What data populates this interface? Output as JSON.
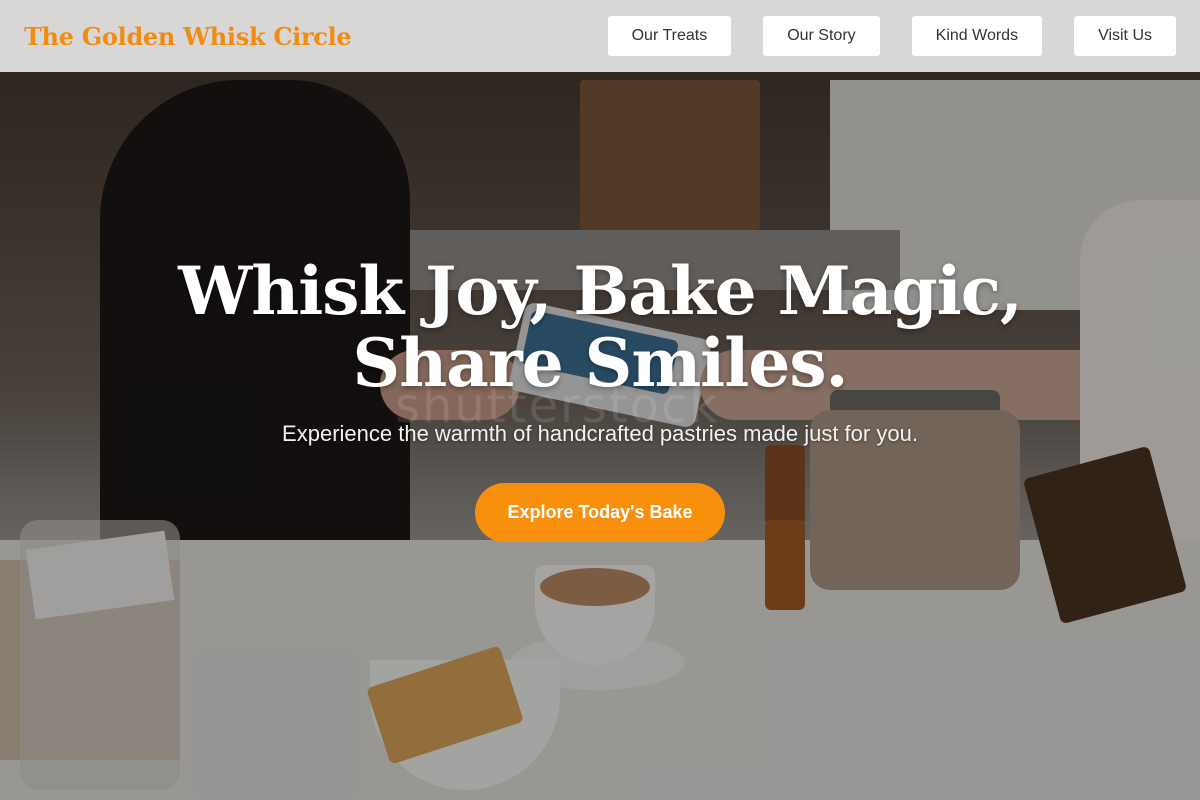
{
  "header": {
    "brand": "The Golden Whisk Circle",
    "nav": [
      {
        "label": "Our Treats"
      },
      {
        "label": "Our Story"
      },
      {
        "label": "Kind Words"
      },
      {
        "label": "Visit Us"
      }
    ]
  },
  "hero": {
    "title": "Whisk Joy, Bake Magic, Share Smiles.",
    "subtitle": "Experience the warmth of handcrafted pastries made just for you.",
    "cta_label": "Explore Today's Bake",
    "watermark": "shutterstock"
  },
  "colors": {
    "accent": "#f9900d",
    "brand": "#f28c0f",
    "header_bg": "#ebebeb"
  }
}
